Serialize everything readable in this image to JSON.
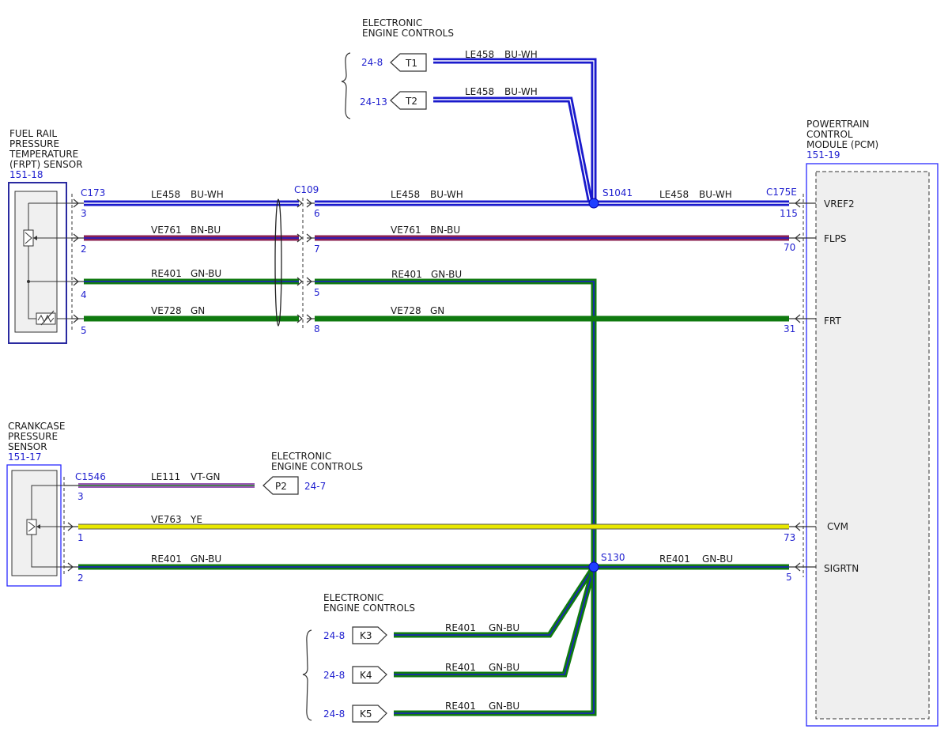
{
  "components": {
    "frpt_sensor": {
      "title_lines": [
        "FUEL RAIL",
        "PRESSURE",
        "TEMPERATURE",
        "(FRPT) SENSOR"
      ],
      "ref": "151-18"
    },
    "crankcase_sensor": {
      "title_lines": [
        "CRANKCASE",
        "PRESSURE",
        "SENSOR"
      ],
      "ref": "151-17"
    },
    "pcm": {
      "title_lines": [
        "POWERTRAIN",
        "CONTROL",
        "MODULE (PCM)"
      ],
      "ref": "151-19",
      "pins": [
        {
          "name": "VREF2",
          "pin": "115"
        },
        {
          "name": "FLPS",
          "pin": "70"
        },
        {
          "name": "FRT",
          "pin": "31"
        },
        {
          "name": "CVM",
          "pin": "73"
        },
        {
          "name": "SIGRTN",
          "pin": "5"
        }
      ]
    }
  },
  "connectors": {
    "c173": {
      "label": "C173",
      "pins": [
        "3",
        "2",
        "4",
        "5"
      ]
    },
    "c109": {
      "label": "C109",
      "pins": [
        "6",
        "7",
        "5",
        "8"
      ]
    },
    "c175e": {
      "label": "C175E"
    },
    "c1546": {
      "label": "C1546",
      "pins": [
        "3",
        "1",
        "2"
      ]
    }
  },
  "splices": {
    "s1041": {
      "label": "S1041"
    },
    "s130": {
      "label": "S130"
    }
  },
  "groups": {
    "top": {
      "title_lines": [
        "ELECTRONIC",
        "ENGINE CONTROLS"
      ]
    },
    "p2": {
      "title_lines": [
        "ELECTRONIC",
        "ENGINE CONTROLS"
      ]
    },
    "bottom": {
      "title_lines": [
        "ELECTRONIC",
        "ENGINE CONTROLS"
      ]
    }
  },
  "refs": [
    {
      "tag": "T1",
      "ref": "24-8"
    },
    {
      "tag": "T2",
      "ref": "24-13"
    },
    {
      "tag": "P2",
      "ref": "24-7"
    },
    {
      "tag": "K3",
      "ref": "24-8"
    },
    {
      "tag": "K4",
      "ref": "24-8"
    },
    {
      "tag": "K5",
      "ref": "24-8"
    }
  ],
  "wire_labels": [
    {
      "circuit": "LE458",
      "color": "BU-WH"
    },
    {
      "circuit": "LE458",
      "color": "BU-WH"
    },
    {
      "circuit": "LE458",
      "color": "BU-WH"
    },
    {
      "circuit": "LE458",
      "color": "BU-WH"
    },
    {
      "circuit": "LE458",
      "color": "BU-WH"
    },
    {
      "circuit": "VE761",
      "color": "BN-BU"
    },
    {
      "circuit": "VE761",
      "color": "BN-BU"
    },
    {
      "circuit": "RE401",
      "color": "GN-BU"
    },
    {
      "circuit": "RE401",
      "color": "GN-BU"
    },
    {
      "circuit": "VE728",
      "color": "GN"
    },
    {
      "circuit": "VE728",
      "color": "GN"
    },
    {
      "circuit": "LE111",
      "color": "VT-GN"
    },
    {
      "circuit": "VE763",
      "color": "YE"
    },
    {
      "circuit": "RE401",
      "color": "GN-BU"
    },
    {
      "circuit": "RE401",
      "color": "GN-BU"
    },
    {
      "circuit": "RE401",
      "color": "GN-BU"
    },
    {
      "circuit": "RE401",
      "color": "GN-BU"
    },
    {
      "circuit": "RE401",
      "color": "GN-BU"
    }
  ],
  "colors": {
    "BU-WH": {
      "base": "#1a1acc",
      "stripe": "#ffffff"
    },
    "BN-BU": {
      "base": "#8b2252",
      "stripe": "#1a1acc"
    },
    "GN-BU": {
      "base": "#107a10",
      "stripe": "#1a1acc"
    },
    "GN": {
      "base": "#0f7a0f"
    },
    "VT-GN": {
      "base": "#9b59b6",
      "stripe": "#2e8b2e"
    },
    "YE": {
      "base": "#e8e800",
      "outline": "#555555"
    },
    "label_blue": "#1f1fcf",
    "splice_blue": "#1f3fff"
  }
}
